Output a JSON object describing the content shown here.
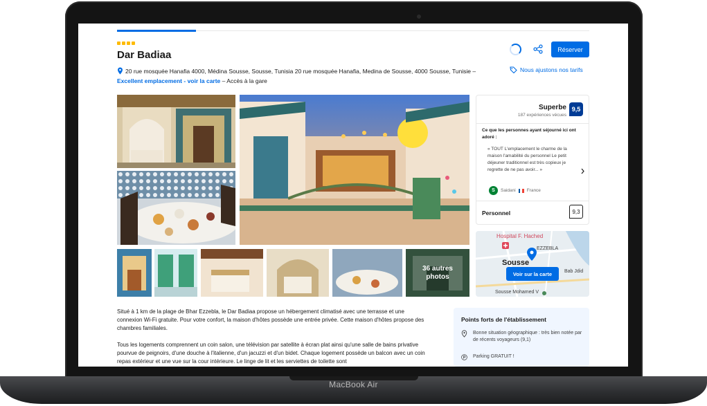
{
  "device": {
    "label": "MacBook Air"
  },
  "property": {
    "title": "Dar Badiaa",
    "stars": 4,
    "address": "20 rue mosquée Hanafia 4000, Médina Sousse, Sousse, Tunisia 20 rue mosquée Hanafia, Medina de Sousse, 4000 Sousse, Tunisie –",
    "location_link": "Excellent emplacement - voir la carte",
    "location_suffix": "– Accès à la gare"
  },
  "actions": {
    "book_label": "Réserver",
    "price_match": "Nous ajustons nos tarifs"
  },
  "gallery": {
    "more_count": "36 autres",
    "more_word": "photos"
  },
  "review": {
    "score_word": "Superbe",
    "review_count": "187 expériences vécues",
    "score": "9,5",
    "intro": "Ce que les personnes ayant séjourné ici ont adoré :",
    "quote": "« TOUT L'emplacement le charme de la maison l'amabilité du personnel Le petit déjeuner traditionnel est très copieux je regrette de ne pas avoir... »",
    "author_initial": "S",
    "author_name": "Saidani",
    "author_country": "France",
    "staff_label": "Personnel",
    "staff_score": "9,3"
  },
  "map": {
    "button_label": "Voir sur la carte",
    "labels": [
      "Hospital F. Hached",
      "EZZEBLA",
      "Sousse",
      "Bab Jdid",
      "Sousse Mohamed V"
    ]
  },
  "description": [
    "Situé à 1 km de la plage de Bhar Ezzebla, le Dar Badiaa propose un hébergement climatisé avec une terrasse et une connexion Wi-Fi gratuite. Pour votre confort, la maison d'hôtes possède une entrée privée. Cette maison d'hôtes propose des chambres familiales.",
    "Tous les logements comprennent un coin salon, une télévision par satellite à écran plat ainsi qu'une salle de bains privative pourvue de peignoirs, d'une douche à l'italienne, d'un jacuzzi et d'un bidet. Chaque logement possède un balcon avec un coin repas extérieur et une vue sur la cour intérieure. Le linge de lit et les serviettes de toilette sont"
  ],
  "highlights": {
    "title": "Points forts de l'établissement",
    "location": "Bonne situation géographique : très bien notée par de récents voyageurs (9,1)",
    "parking": "Parking GRATUIT !"
  },
  "colors": {
    "accent": "#006ce4",
    "score_badge": "#003b95",
    "star": "#febb02",
    "highlights_bg": "#f0f6ff"
  }
}
